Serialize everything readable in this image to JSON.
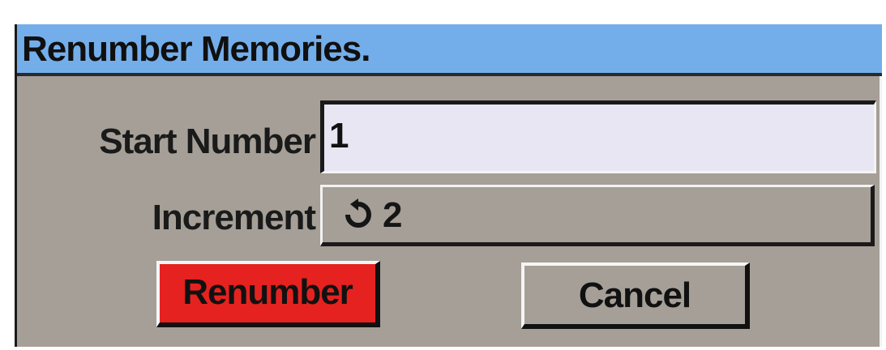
{
  "dialog": {
    "title": "Renumber Memories."
  },
  "fields": {
    "start_number_label": "Start Number",
    "start_number_value": "1",
    "increment_label": "Increment",
    "increment_value": "2",
    "increment_icon": "cycle-icon"
  },
  "buttons": {
    "renumber_label": "Renumber",
    "cancel_label": "Cancel"
  },
  "colors": {
    "titlebar": "#74aeea",
    "dialog_bg": "#a59f97",
    "primary_button": "#e5221f",
    "input_bg": "#e8e6f2"
  }
}
